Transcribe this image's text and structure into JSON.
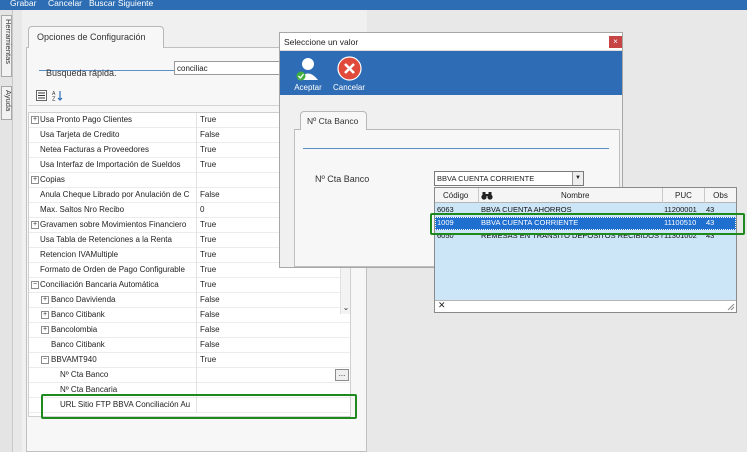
{
  "menu": {
    "items": [
      "Grabar",
      "Cancelar",
      "Buscar Siguiente"
    ]
  },
  "side_tabs": [
    "Herramientas",
    "Ayuda"
  ],
  "config": {
    "tab_label": "Opciones de Configuración",
    "search_label": "Busqueda rápida.",
    "search_value": "conciliac",
    "rows": [
      {
        "name": "Usa Pronto Pago Clientes",
        "value": "True",
        "expander": "+",
        "indent": 0
      },
      {
        "name": "Usa Tarjeta de Credito",
        "value": "False",
        "expander": "",
        "indent": 0
      },
      {
        "name": "Netea Facturas a Proveedores",
        "value": "True",
        "expander": "",
        "indent": 0
      },
      {
        "name": "Usa Interfaz de Importación de Sueldos",
        "value": "True",
        "expander": "",
        "indent": 0
      },
      {
        "name": "Copias",
        "value": "",
        "expander": "+",
        "indent": 0
      },
      {
        "name": "Anula Cheque Librado por Anulación de C",
        "value": "False",
        "expander": "",
        "indent": 0
      },
      {
        "name": "Max. Saltos Nro Recibo",
        "value": "0",
        "expander": "",
        "indent": 0
      },
      {
        "name": "Gravamen sobre Movimientos Financiero",
        "value": "True",
        "expander": "+",
        "indent": 0
      },
      {
        "name": "Usa Tabla de Retenciones a la Renta",
        "value": "True",
        "expander": "",
        "indent": 0
      },
      {
        "name": "Retencion IVAMultiple",
        "value": "True",
        "expander": "",
        "indent": 0
      },
      {
        "name": "Formato de Orden de Pago Configurable",
        "value": "True",
        "expander": "",
        "indent": 0
      },
      {
        "name": "Conciliación Bancaria Automática",
        "value": "True",
        "expander": "−",
        "indent": 0
      },
      {
        "name": "Banco Davivienda",
        "value": "False",
        "expander": "+",
        "indent": 1
      },
      {
        "name": "Banco Citibank",
        "value": "False",
        "expander": "+",
        "indent": 1
      },
      {
        "name": "Bancolombia",
        "value": "False",
        "expander": "+",
        "indent": 1
      },
      {
        "name": "Banco Citibank",
        "value": "False",
        "expander": "",
        "indent": 1
      },
      {
        "name": "BBVAMT940",
        "value": "True",
        "expander": "−",
        "indent": 1
      },
      {
        "name": "Nº Cta Banco",
        "value": "",
        "expander": "",
        "indent": 2,
        "has_button": true,
        "button_label": "..."
      },
      {
        "name": "Nº Cta Bancaria",
        "value": "",
        "expander": "",
        "indent": 2
      },
      {
        "name": "URL Sitio FTP BBVA Conciliación Au",
        "value": "",
        "expander": "",
        "indent": 2
      }
    ],
    "scroll_down_glyph": "⌄"
  },
  "dialog": {
    "title": "Seleccione un valor",
    "close_glyph": "×",
    "accept_label": "Aceptar",
    "cancel_label": "Cancelar",
    "tab_label": "Nº Cta Banco",
    "field_label": "Nº Cta Banco",
    "combo_value": "BBVA CUENTA CORRIENTE",
    "combo_arrow": "▼",
    "columns": [
      "Código",
      "Nombre",
      "PUC",
      "Obs"
    ],
    "rows": [
      {
        "codigo": "6063",
        "nombre": "BBVA CUENTA AHORROS",
        "puc": "11200001",
        "obs": "43",
        "selected": false
      },
      {
        "codigo": "1009",
        "nombre": "BBVA CUENTA CORRIENTE",
        "puc": "11100510",
        "obs": "43",
        "selected": true
      },
      {
        "codigo": "6050",
        "nombre": "REMESAS EN TRANSITO DEPOSITOS RECIBIDOS MC",
        "puc": "11301002",
        "obs": "43",
        "selected": false
      }
    ],
    "footer_close": "✕"
  },
  "colors": {
    "accent": "#2e6db5",
    "selection": "#1f6fd0",
    "highlight": "#1e8a1e",
    "close": "#c74444"
  }
}
